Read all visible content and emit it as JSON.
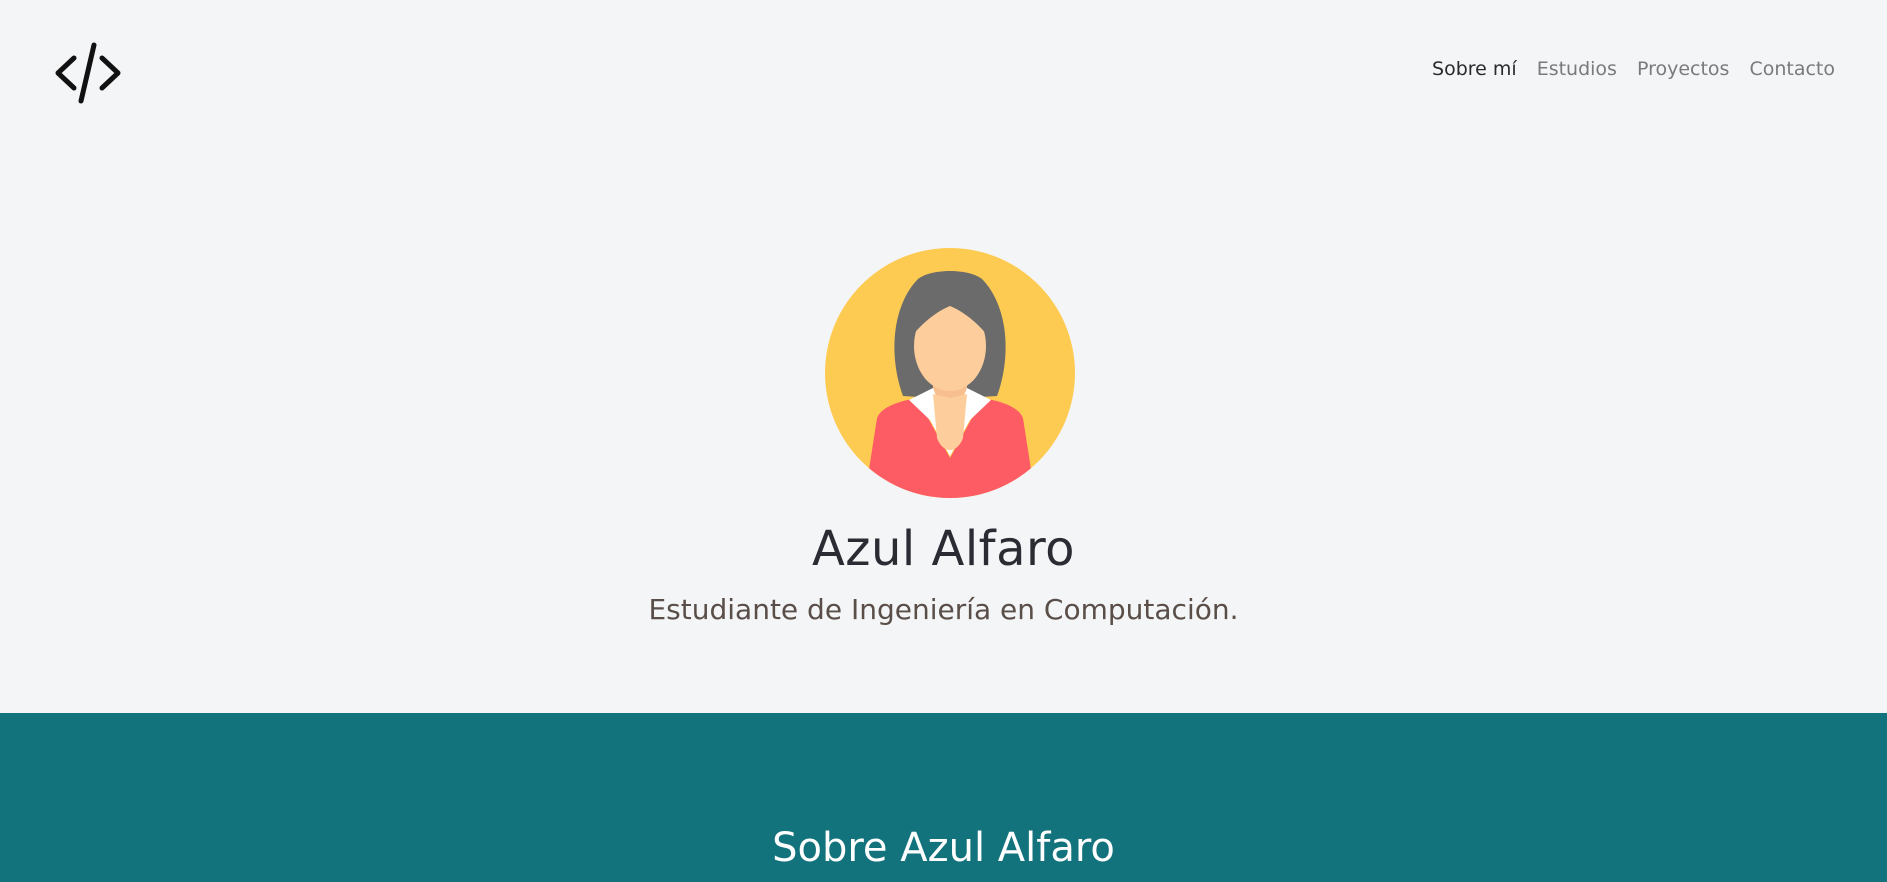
{
  "nav": {
    "logo_icon": "code-brackets-icon",
    "links": [
      {
        "label": "Sobre mí",
        "active": true
      },
      {
        "label": "Estudios",
        "active": false
      },
      {
        "label": "Proyectos",
        "active": false
      },
      {
        "label": "Contacto",
        "active": false
      }
    ]
  },
  "hero": {
    "avatar_icon": "woman-avatar-icon",
    "name": "Azul Alfaro",
    "subtitle": "Estudiante de Ingeniería en Computación."
  },
  "about": {
    "title": "Sobre Azul Alfaro"
  },
  "colors": {
    "background": "#f4f5f7",
    "accent": "#13737c",
    "avatar_bg": "#fecb52",
    "avatar_shirt": "#fd5c64"
  }
}
